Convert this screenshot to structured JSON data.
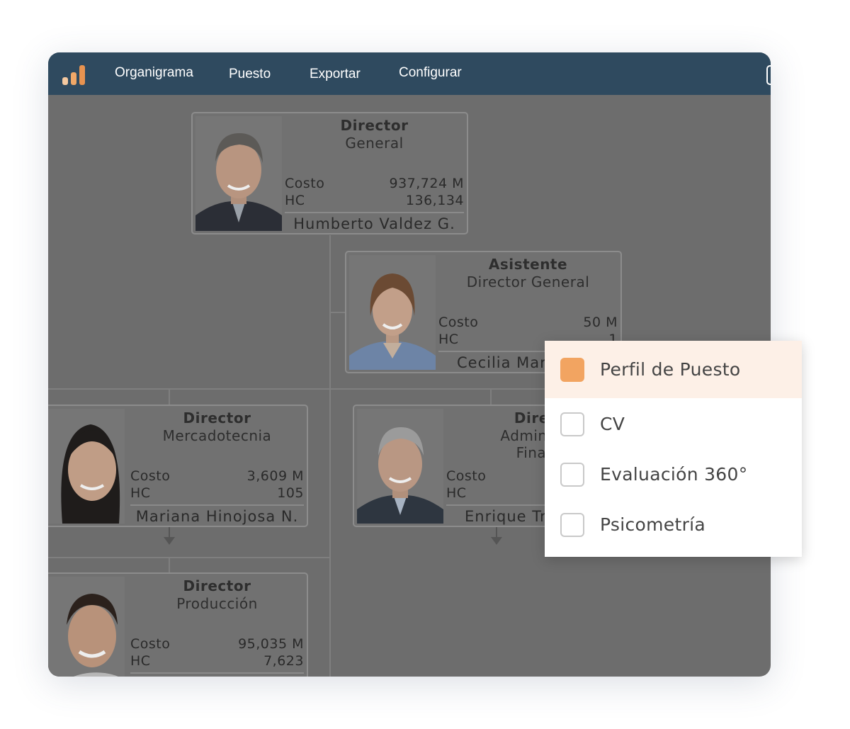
{
  "nav": {
    "items": [
      {
        "label": "Organigrama"
      },
      {
        "label": "Puesto"
      },
      {
        "label": "Exportar"
      },
      {
        "label": "Configurar"
      }
    ]
  },
  "cards": {
    "director_general": {
      "role": "Director",
      "dept": "General",
      "cost_label": "Costo",
      "cost_value": "937,724 M",
      "hc_label": "HC",
      "hc_value": "136,134",
      "name": "Humberto Valdez G."
    },
    "asistente": {
      "role": "Asistente",
      "dept": "Director General",
      "cost_label": "Costo",
      "cost_value": "50 M",
      "hc_label": "HC",
      "hc_value": "1",
      "name": "Cecilia Mar"
    },
    "mercadotecnia": {
      "role": "Director",
      "dept": "Mercadotecnia",
      "cost_label": "Costo",
      "cost_value": "3,609 M",
      "hc_label": "HC",
      "hc_value": "105",
      "name": "Mariana Hinojosa N."
    },
    "administracion": {
      "role": "Direc",
      "dept_line1": "Administr",
      "dept_line2": "Finan",
      "cost_label": "Costo",
      "hc_label": "HC",
      "name": "Enrique Tr"
    },
    "produccion": {
      "role": "Director",
      "dept": "Producción",
      "cost_label": "Costo",
      "cost_value": "95,035 M",
      "hc_label": "HC",
      "hc_value": "7,623"
    }
  },
  "context_menu": {
    "items": [
      {
        "label": "Perfil de Puesto",
        "checked": true
      },
      {
        "label": "CV",
        "checked": false
      },
      {
        "label": "Evaluación 360°",
        "checked": false
      },
      {
        "label": "Psicometría",
        "checked": false
      }
    ]
  },
  "colors": {
    "topbar": "#2f4a5f",
    "accent": "#f2a461",
    "menu_active_bg": "#fdf0e7",
    "overlay": "#6d6d6d"
  },
  "icons": [
    "bar-chart-logo-icon",
    "window-control-icon",
    "arrow-down-icon",
    "checkbox-icon"
  ]
}
